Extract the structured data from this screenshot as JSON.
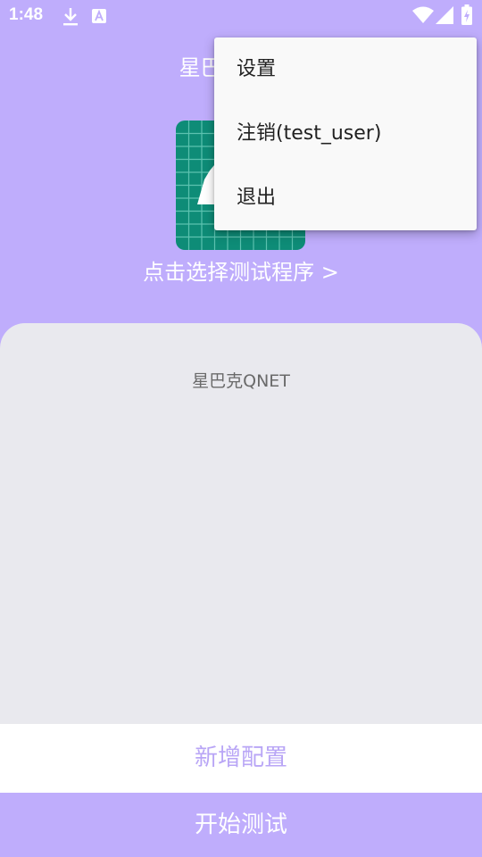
{
  "status_bar": {
    "time": "1:48",
    "icons": [
      "download-icon",
      "font-app-icon",
      "wifi-icon",
      "signal-icon",
      "battery-charging-icon"
    ]
  },
  "header": {
    "title": "星巴克QNET"
  },
  "app_icon": {
    "icon": "chess-piece-grid-icon",
    "color": "#0e8c77"
  },
  "select_program_label": "点击选择测试程序 >",
  "config_panel": {
    "config_name": "星巴克QNET"
  },
  "buttons": {
    "add_config": "新增配置",
    "start_test": "开始测试"
  },
  "overflow_menu": {
    "items": [
      {
        "label": "设置"
      },
      {
        "label": "注销(test_user)"
      },
      {
        "label": "退出"
      }
    ]
  },
  "colors": {
    "background": "#bfadfc",
    "panel": "#e9e9ee",
    "accent_text": "#b9a6f6",
    "menu_background": "#f9f9f9"
  }
}
